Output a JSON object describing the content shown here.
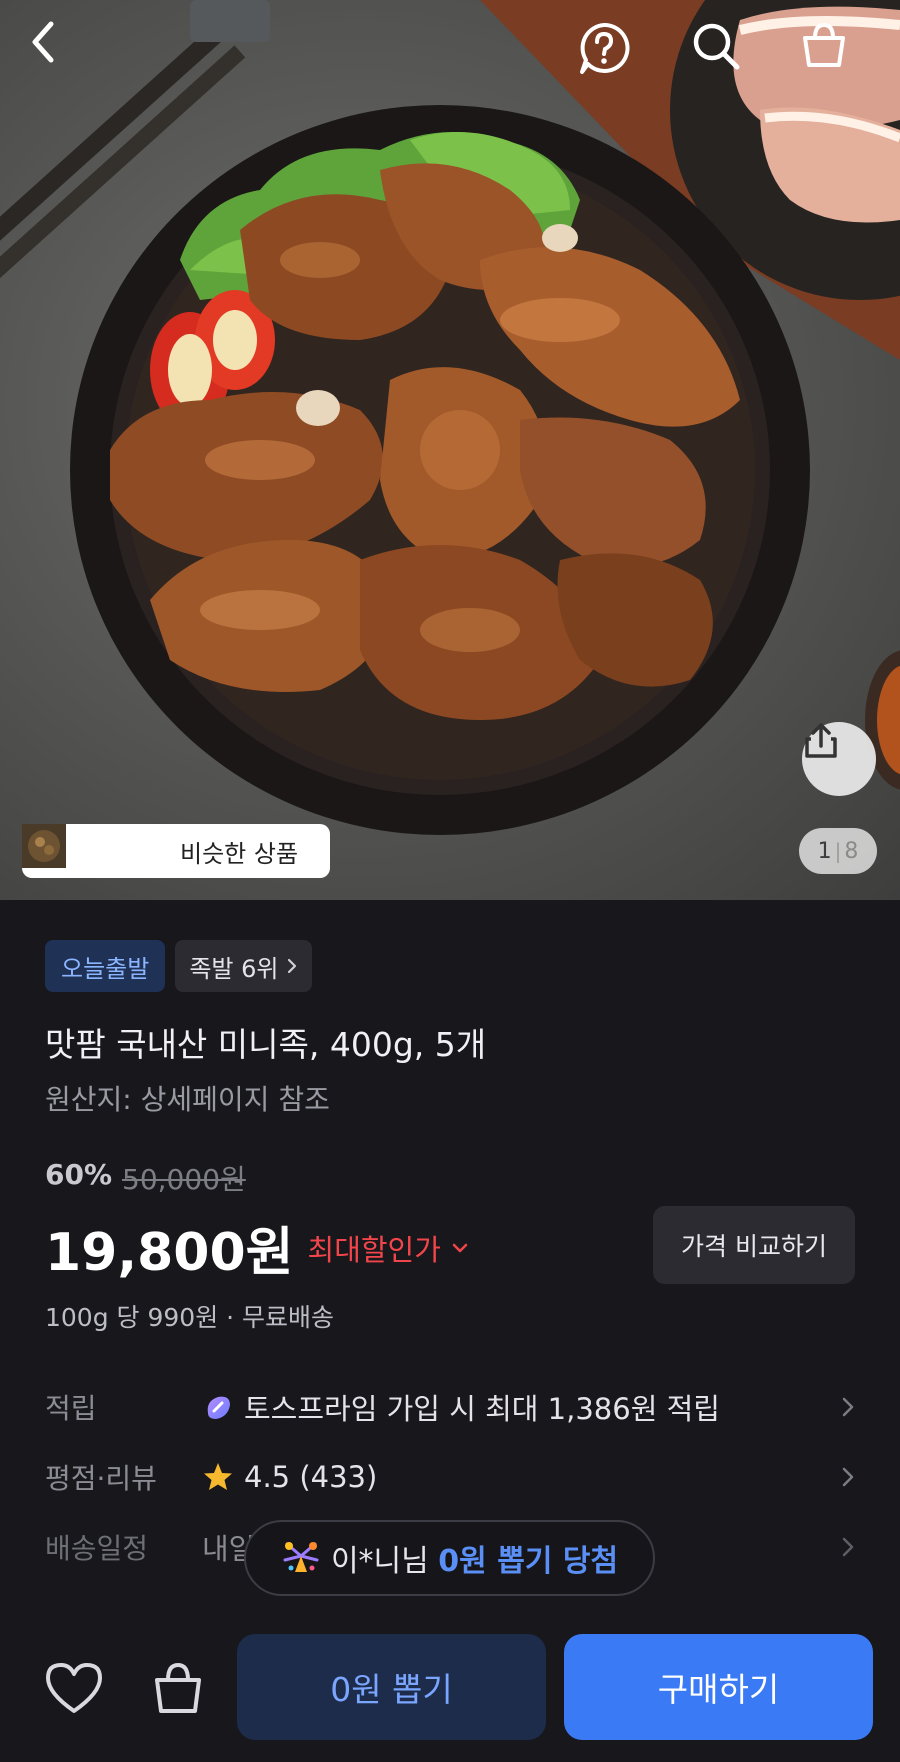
{
  "hero": {
    "page_current": "1",
    "page_separator": "|",
    "page_total": "8",
    "similar_label": "비슷한 상품",
    "icons": [
      "back-arrow-icon",
      "help-question-icon",
      "search-icon",
      "shopping-bag-icon",
      "share-icon"
    ]
  },
  "product": {
    "badge_today": "오늘출발",
    "badge_rank": "족발 6위",
    "title": "맛팜 국내산 미니족, 400g, 5개",
    "origin": "원산지: 상세페이지 참조",
    "discount_percent": "60%",
    "original_price": "50,000원",
    "price": "19,800원",
    "max_discount_label": "최대할인가",
    "compare_label": "가격 비교하기",
    "unit_price": "100g 당 990원 · 무료배송"
  },
  "info": {
    "points_key": "적립",
    "points_value": "토스프라임 가입 시 최대 1,386원 적립",
    "rating_key": "평점·리뷰",
    "rating_value": "4.5 (433)",
    "delivery_key": "배송일정",
    "delivery_value": "내일"
  },
  "toast": {
    "name": "이*니님",
    "highlight": "0원 뽑기 당첨"
  },
  "bottom": {
    "draw_label": "0원 뽑기",
    "buy_label": "구매하기"
  },
  "colors": {
    "background": "#17171c",
    "accent_blue": "#3b7af5",
    "discount_red": "#f0464b",
    "star": "#f5b82e"
  }
}
